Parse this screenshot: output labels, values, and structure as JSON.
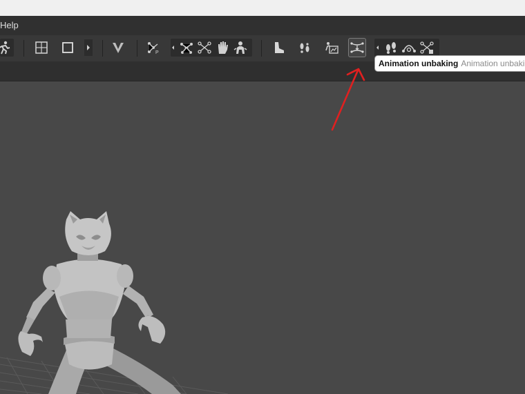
{
  "menu": {
    "help_label": "Help"
  },
  "toolbar": {
    "tools": [
      {
        "icon": "run-figure-icon"
      },
      {
        "icon": "frame-select-icon"
      },
      {
        "icon": "square-select-icon"
      },
      {
        "icon": "v-shape-icon"
      },
      {
        "icon": "node-p-icon"
      },
      {
        "icon": "node-link-icon"
      },
      {
        "icon": "node-cross-icon"
      },
      {
        "icon": "hand-icon"
      },
      {
        "icon": "character-icon"
      },
      {
        "icon": "foot-icon"
      },
      {
        "icon": "footsteps-icon"
      },
      {
        "icon": "image-figure-icon"
      },
      {
        "icon": "animation-unbaking-icon"
      },
      {
        "icon": "footprints-icon"
      },
      {
        "icon": "arc-icon"
      },
      {
        "icon": "node-lock-icon"
      }
    ]
  },
  "tooltip": {
    "title": "Animation unbaking",
    "description": "Animation unbaking"
  },
  "colors": {
    "menubar": "#303030",
    "toolbar": "#383838",
    "viewport": "#484848",
    "annotation_arrow": "#e02020"
  }
}
